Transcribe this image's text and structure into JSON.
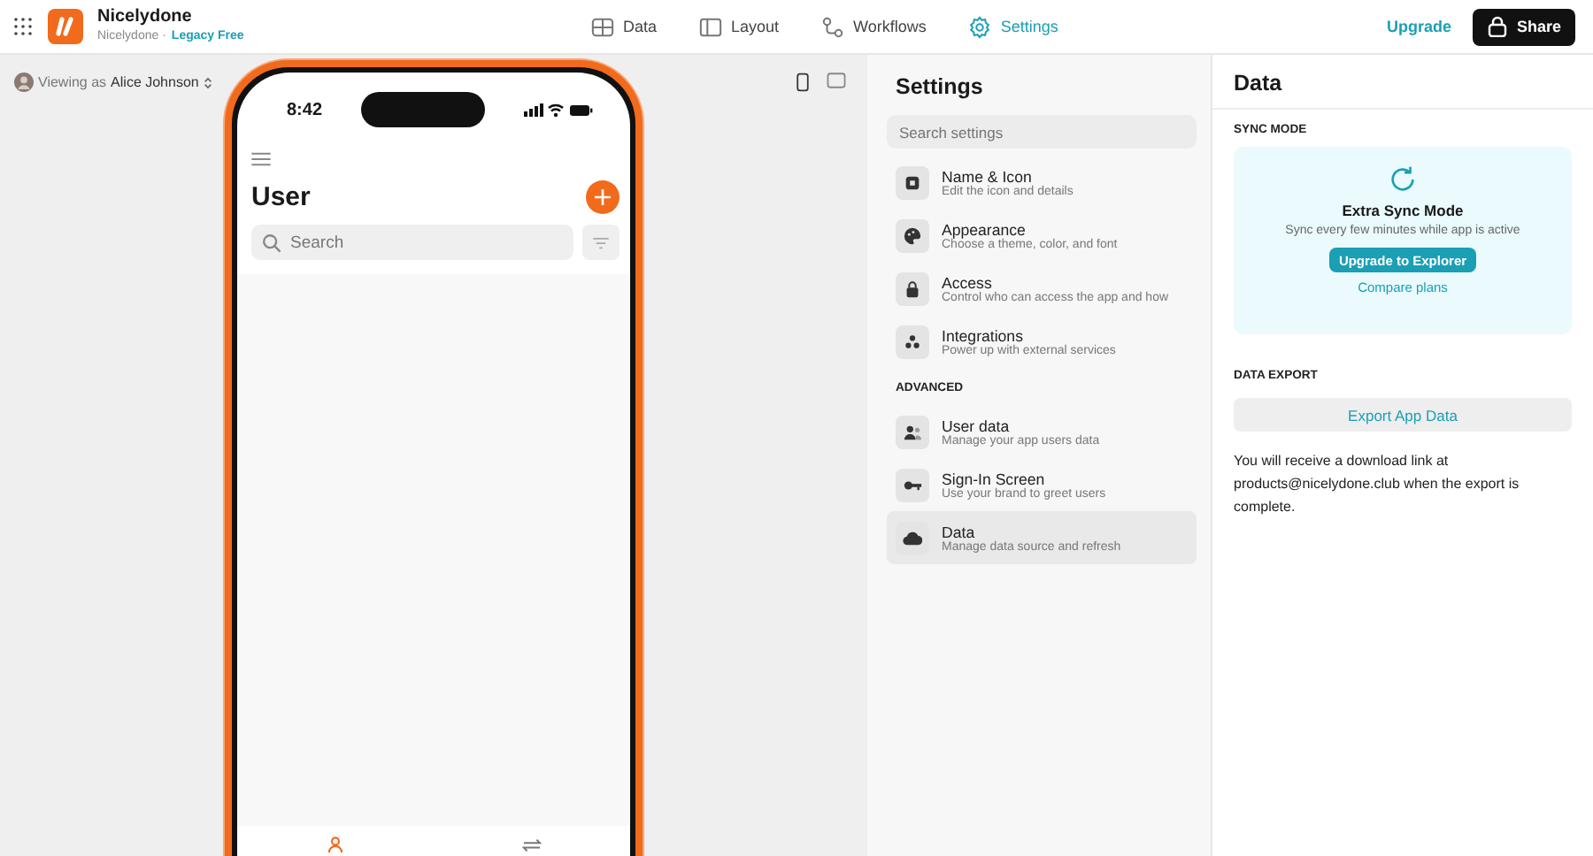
{
  "app": {
    "name": "Nicelydone",
    "workspace": "Nicelydone ·",
    "plan": "Legacy Free"
  },
  "nav_tabs": [
    {
      "label": "Data",
      "kind": "table",
      "selected": false
    },
    {
      "label": "Layout",
      "kind": "layout",
      "selected": false
    },
    {
      "label": "Workflows",
      "kind": "workflow",
      "selected": false
    },
    {
      "label": "Settings",
      "kind": "gear",
      "selected": true
    }
  ],
  "upgrade_link": "Upgrade",
  "share_button": "Share",
  "viewing_as": {
    "prefix": "Viewing as",
    "name": "Alice Johnson"
  },
  "device_toggles": [
    {
      "kind": "phone",
      "selected": true
    },
    {
      "kind": "tablet",
      "selected": false
    }
  ],
  "phone": {
    "time": "8:42",
    "title": "User",
    "search_placeholder": "Search",
    "tabs": [
      {
        "kind": "person",
        "selected": true
      },
      {
        "kind": "arrows",
        "selected": false
      }
    ]
  },
  "settings": {
    "title": "Settings",
    "search_placeholder": "Search settings",
    "groups": [
      {
        "items": [
          {
            "kind": "square",
            "title": "Name & Icon",
            "subtitle": "Edit the icon and details",
            "selected": false
          },
          {
            "kind": "palette",
            "title": "Appearance",
            "subtitle": "Choose a theme, color, and font",
            "selected": false
          },
          {
            "kind": "lock",
            "title": "Access",
            "subtitle": "Control who can access the app and how",
            "selected": false
          },
          {
            "kind": "dots",
            "title": "Integrations",
            "subtitle": "Power up with external services",
            "selected": false
          }
        ]
      },
      {
        "heading": "ADVANCED",
        "items": [
          {
            "kind": "users",
            "title": "User data",
            "subtitle": "Manage your app users data",
            "selected": false
          },
          {
            "kind": "key",
            "title": "Sign-In Screen",
            "subtitle": "Use your brand to greet users",
            "selected": false
          },
          {
            "kind": "cloud",
            "title": "Data",
            "subtitle": "Manage data source and refresh",
            "selected": true
          }
        ]
      }
    ]
  },
  "data_panel": {
    "title": "Data",
    "sync_heading": "SYNC MODE",
    "sync_title": "Extra Sync Mode",
    "sync_text": "Sync every few minutes while app is active",
    "upgrade_button": "Upgrade to Explorer",
    "compare_link": "Compare plans",
    "export_heading": "DATA EXPORT",
    "export_button": "Export App Data",
    "export_note": "You will receive a download link at products@nicelydone.club when the export is complete."
  }
}
